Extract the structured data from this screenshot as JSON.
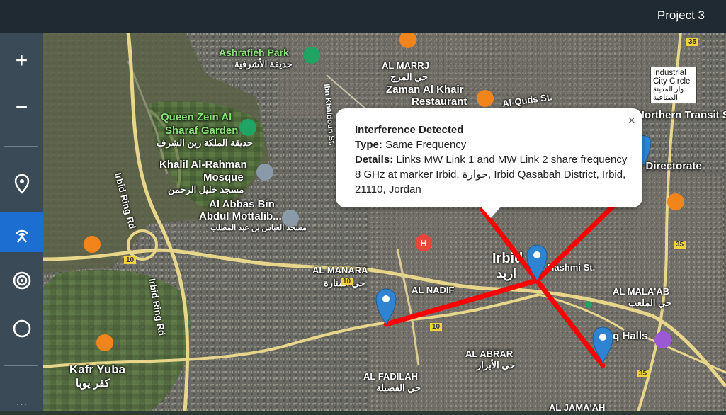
{
  "header": {
    "project": "Project 3"
  },
  "sidebar": {
    "items": [
      {
        "name": "zoom-in-button",
        "glyph": "+"
      },
      {
        "name": "zoom-out-button",
        "glyph": "−"
      }
    ]
  },
  "popup": {
    "title": "Interference Detected",
    "type_label": "Type:",
    "type_value": "Same Frequency",
    "details_label": "Details:",
    "details_value": "Links MW Link 1 and MW Link 2 share frequency 8 GHz at marker Irbid, حوارة, Irbid Qasabah District, Irbid, 21110, Jordan",
    "close": "×"
  },
  "map_labels": {
    "ashrafieh_park": "Ashrafieh Park",
    "ashrafieh_ar": "حديقة الأشرفية",
    "al_marrj": "AL MARRJ",
    "al_marrj_ar": "حي المرج",
    "zaman": "Zaman Al Khair",
    "restaurant": "Restaurant",
    "al_quds": "Al-Quds St.",
    "queen_zein_1": "Queen Zein Al",
    "queen_zein_2": "Sharaf Garden",
    "queen_zein_ar": "حديقة الملكة زين الشرف",
    "khalil_1": "Khalil Al-Rahman",
    "khalil_2": "Mosque",
    "khalil_ar": "مسجد خليل الرحمن",
    "abbas_1": "Al Abbas Bin",
    "abbas_2": "Abdul Mottalib...",
    "abbas_ar": "مسجد العباس بن عبد المطلب",
    "irbid_ring_1": "Irbid Ring Rd",
    "irbid_ring_2": "Irbid Ring Rd",
    "ibn_khaldoun": "Ibn Khaldoun St.",
    "al_manara": "AL MANARA",
    "al_manara_ar": "حي المنارة",
    "al_nadif": "AL NADIF",
    "irbid": "Irbid",
    "irbid_ar": "اربد",
    "hashmi": "Hashmi St.",
    "al_malaab": "AL MALA'AB",
    "al_malaab_ar": "حي الملعب",
    "kafr_yuba": "Kafr Yuba",
    "kafr_yuba_ar": "كفر يوبا",
    "al_abrar": "AL ABRAR",
    "al_abrar_ar": "حي الأبرار",
    "al_fadilah": "AL FADILAH",
    "al_fadilah_ar": "حي الفضيلة",
    "al_jamaah": "AL JAMA'AH",
    "transit": "Northern Transit Sta",
    "directorate": "c Directorate",
    "halls": "S   q Halls",
    "industrial_1": "Industrial",
    "industrial_2": "City Circle",
    "industrial_ar": "دوار المدينة الصناعية",
    "road_10a": "10",
    "road_10b": "10",
    "road_10c": "10",
    "road_35a": "35",
    "road_35b": "35",
    "road_35c": "35"
  }
}
